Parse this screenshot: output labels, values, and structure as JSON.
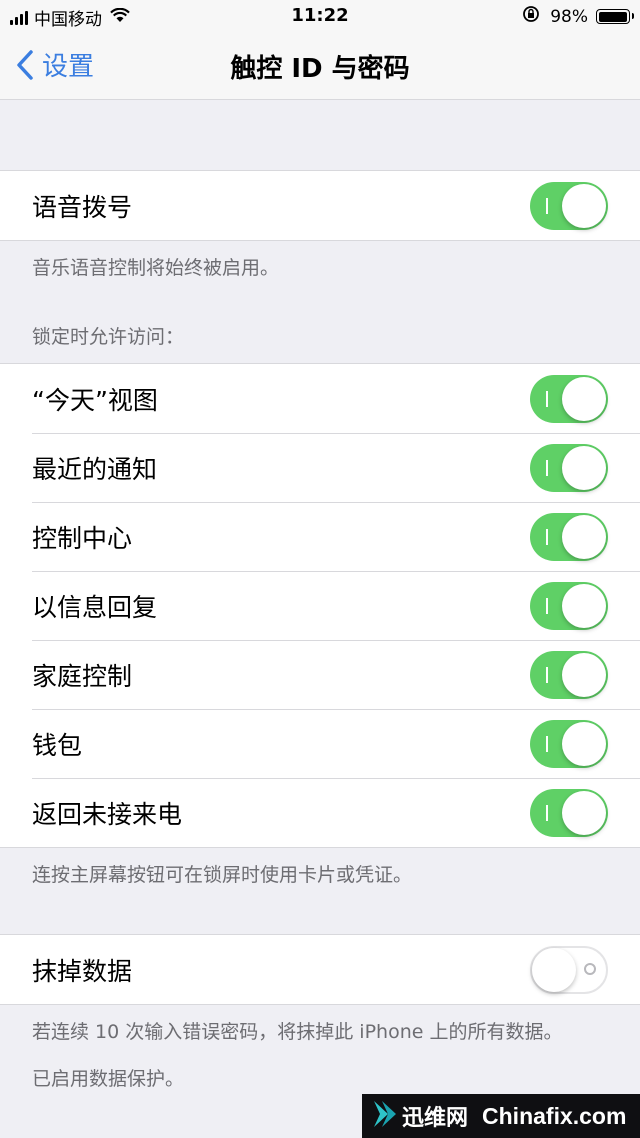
{
  "status_bar": {
    "carrier": "中国移动",
    "time": "11:22",
    "battery_percent": "98%",
    "battery_level": 0.98
  },
  "nav": {
    "back_label": "设置",
    "title": "触控 ID 与密码"
  },
  "voice_dial": {
    "label": "语音拨号",
    "on": true,
    "footer": "音乐语音控制将始终被启用。"
  },
  "locked_access": {
    "header": "锁定时允许访问：",
    "items": [
      {
        "label": "“今天”视图",
        "on": true
      },
      {
        "label": "最近的通知",
        "on": true
      },
      {
        "label": "控制中心",
        "on": true
      },
      {
        "label": "以信息回复",
        "on": true
      },
      {
        "label": "家庭控制",
        "on": true
      },
      {
        "label": "钱包",
        "on": true
      },
      {
        "label": "返回未接来电",
        "on": true
      }
    ],
    "footer": "连按主屏幕按钮可在锁屏时使用卡片或凭证。"
  },
  "erase_data": {
    "label": "抹掉数据",
    "on": false,
    "footer_line1": "若连续 10 次输入错误密码，将抹掉此 iPhone 上的所有数据。",
    "footer_line2": "已启用数据保护。"
  },
  "watermark": {
    "cn": "迅维网",
    "en": "Chinafix.com"
  },
  "colors": {
    "toggle_on": "#5fd066",
    "accent_blue": "#3b7ee0",
    "background": "#efeff4"
  }
}
